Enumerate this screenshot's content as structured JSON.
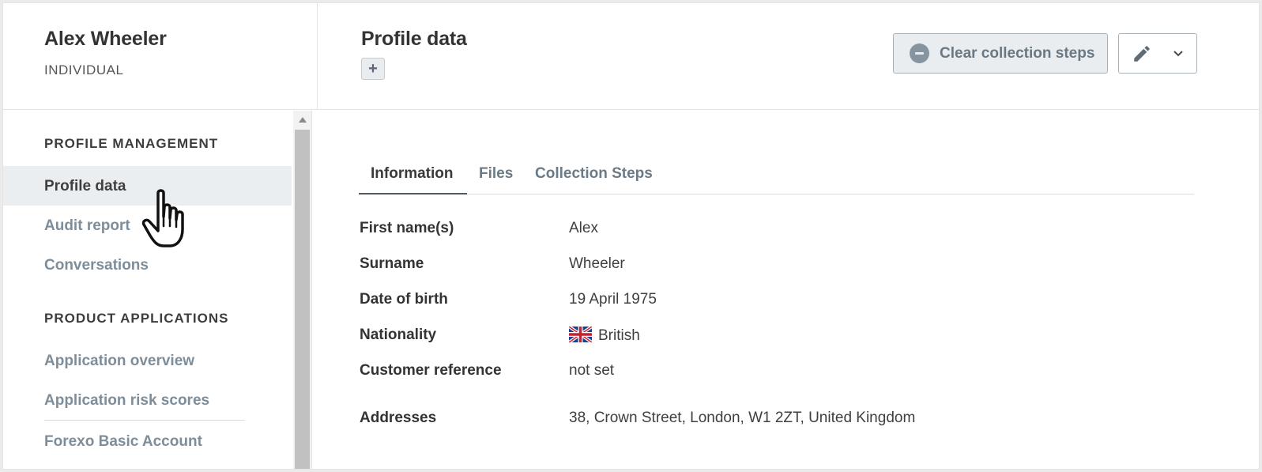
{
  "header": {
    "profile_name": "Alex Wheeler",
    "profile_type": "INDIVIDUAL",
    "page_title": "Profile data",
    "add_label": "+",
    "clear_button": "Clear collection steps"
  },
  "sidebar": {
    "sections": [
      {
        "heading": "PROFILE MANAGEMENT"
      },
      {
        "heading": "PRODUCT APPLICATIONS"
      }
    ],
    "items": [
      {
        "label": "Profile data",
        "active": true
      },
      {
        "label": "Audit report"
      },
      {
        "label": "Conversations"
      },
      {
        "label": "Application overview"
      },
      {
        "label": "Application risk scores"
      },
      {
        "label": "Forexo Basic Account"
      }
    ]
  },
  "tabs": [
    {
      "label": "Information",
      "active": true
    },
    {
      "label": "Files"
    },
    {
      "label": "Collection Steps"
    }
  ],
  "fields": [
    {
      "label": "First name(s)",
      "value": "Alex"
    },
    {
      "label": "Surname",
      "value": "Wheeler"
    },
    {
      "label": "Date of birth",
      "value": "19 April 1975"
    },
    {
      "label": "Nationality",
      "value": "British",
      "icon": "uk-flag-icon"
    },
    {
      "label": "Customer reference",
      "value": "not set"
    },
    {
      "label": "Addresses",
      "value": "38, Crown Street, London, W1 2ZT, United Kingdom"
    }
  ],
  "colors": {
    "active_nav_bg": "#ebeef0",
    "link_gray": "#7d8d99",
    "button_bg": "#e9edf0",
    "button_border": "#a9b2b9"
  }
}
